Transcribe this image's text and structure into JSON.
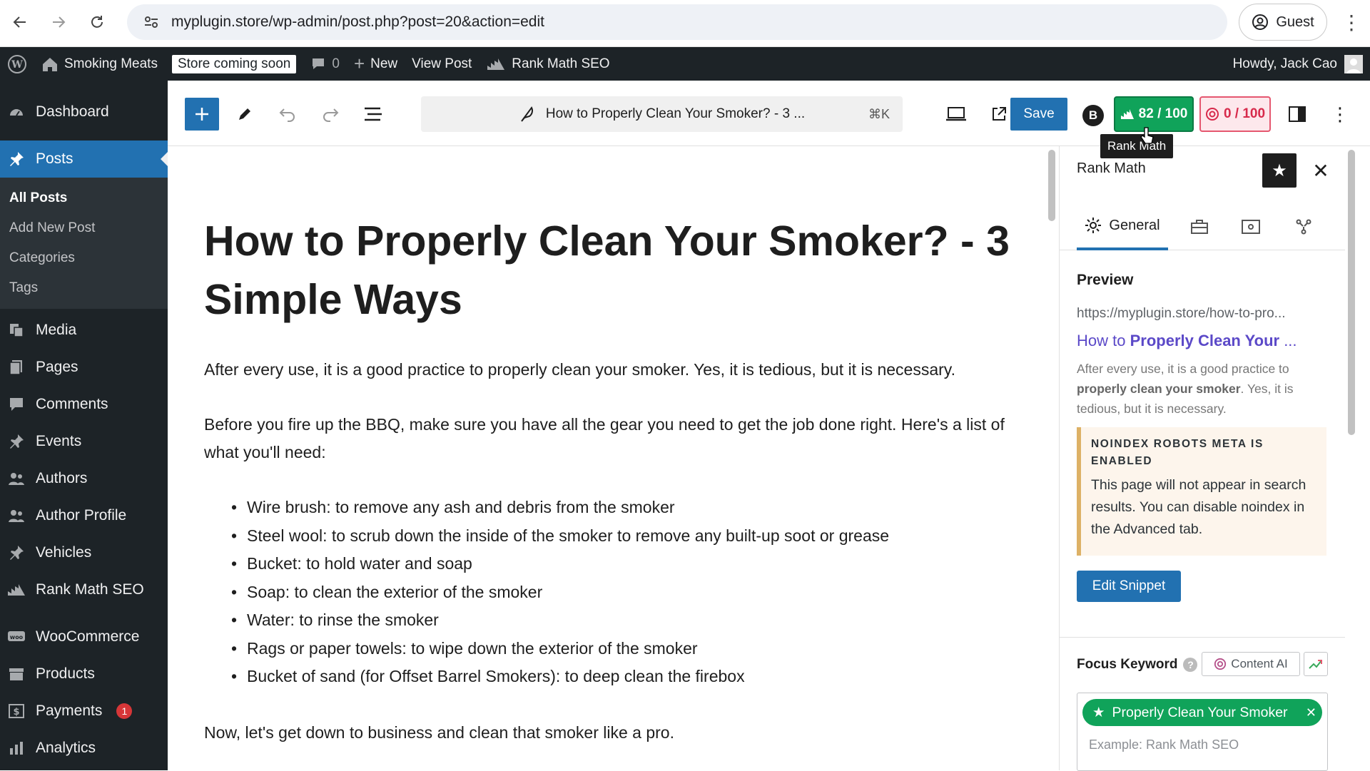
{
  "browser": {
    "url": "myplugin.store/wp-admin/post.php?post=20&action=edit",
    "profile_label": "Guest"
  },
  "adminbar": {
    "site_name": "Smoking Meats",
    "store_badge": "Store coming soon",
    "comments_count": "0",
    "new_label": "New",
    "view_post_label": "View Post",
    "seo_label": "Rank Math SEO",
    "howdy": "Howdy, Jack Cao"
  },
  "sidebar": {
    "items": [
      {
        "label": "Dashboard",
        "icon": "dashboard-icon"
      },
      {
        "label": "Posts",
        "icon": "pin-icon",
        "active": true
      },
      {
        "label": "Media",
        "icon": "media-icon"
      },
      {
        "label": "Pages",
        "icon": "pages-icon"
      },
      {
        "label": "Comments",
        "icon": "comment-icon"
      },
      {
        "label": "Events",
        "icon": "pin-icon"
      },
      {
        "label": "Authors",
        "icon": "users-icon"
      },
      {
        "label": "Author Profile",
        "icon": "users-icon"
      },
      {
        "label": "Vehicles",
        "icon": "pin-icon"
      },
      {
        "label": "Rank Math SEO",
        "icon": "chart-icon"
      },
      {
        "label": "WooCommerce",
        "icon": "woo-icon"
      },
      {
        "label": "Products",
        "icon": "box-icon"
      },
      {
        "label": "Payments",
        "icon": "dollar-icon",
        "badge": "1"
      },
      {
        "label": "Analytics",
        "icon": "bars-icon"
      }
    ],
    "posts_sub": [
      "All Posts",
      "Add New Post",
      "Categories",
      "Tags"
    ]
  },
  "toolbar": {
    "doc_title": "How to Properly Clean Your Smoker? - 3 ...",
    "shortcut": "⌘K",
    "save_label": "Save",
    "b_letter": "B",
    "seo_score": "82 / 100",
    "content_score": "0 / 100",
    "tooltip": "Rank Math"
  },
  "post": {
    "title": "How to Properly Clean Your Smoker? - 3 Simple Ways",
    "p1": "After every use, it is a good practice to properly clean your smoker. Yes, it is tedious, but it is necessary.",
    "p2": "Before you fire up the BBQ, make sure you have all the gear you need to get the job done right. Here's a list of what you'll need:",
    "list": [
      "Wire brush: to remove any ash and debris from the smoker",
      "Steel wool: to scrub down the inside of the smoker to remove any built-up soot or grease",
      "Bucket: to hold water and soap",
      "Soap: to clean the exterior of the smoker",
      "Water: to rinse the smoker",
      "Rags or paper towels: to wipe down the exterior of the smoker",
      "Bucket of sand (for Offset Barrel Smokers): to deep clean the firebox"
    ],
    "p3": "Now, let's get down to business and clean that smoker like a pro."
  },
  "panel": {
    "title": "Rank Math",
    "tab_general": "General",
    "preview_heading": "Preview",
    "preview_url": "https://myplugin.store/how-to-pro...",
    "preview_title_plain": "How to ",
    "preview_title_bold": "Properly Clean Your",
    "preview_title_tail": " ...",
    "preview_desc_1": "After every use, it is a good practice to ",
    "preview_desc_bold": "properly clean your smoker",
    "preview_desc_2": ". Yes, it is tedious, but it is necessary.",
    "notice_title": "NOINDEX ROBOTS META IS ENABLED",
    "notice_body": "This page will not appear in search results. You can disable noindex in the Advanced tab.",
    "edit_snippet": "Edit Snippet",
    "focus_keyword": "Focus Keyword",
    "content_ai": "Content AI",
    "keyword": "Properly Clean Your Smoker",
    "keyword_placeholder": "Example: Rank Math SEO"
  },
  "colors": {
    "wp_blue": "#2271b1",
    "admin_dark": "#1d2327",
    "score_green": "#10a35a",
    "score_pink": "#d72a4b"
  }
}
